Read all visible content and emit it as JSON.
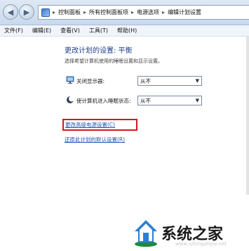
{
  "address_bar": {
    "crumbs": [
      "控制面板",
      "所有控制面板项",
      "电源选项",
      "编辑计划设置"
    ]
  },
  "menu": [
    "文件(F)",
    "编辑(E)",
    "查看(V)",
    "工具(T)",
    "帮助(H)"
  ],
  "page": {
    "title": "更改计划的设置: 平衡",
    "subtitle": "选择希望计算机使用的睡眠设置和显示设置。",
    "settings": [
      {
        "label": "关闭显示器:",
        "value": "从不",
        "icon": "monitor-icon"
      },
      {
        "label": "使计算机进入睡眠状态:",
        "value": "从不",
        "icon": "moon-icon"
      }
    ],
    "advanced_link": "更改高级电源设置(C)",
    "restore_link": "还原此计划的默认设置(R)"
  },
  "watermark": {
    "text": "系统之家",
    "url": "www.xitongzhijia.net"
  },
  "colors": {
    "link": "#1f56b8",
    "title": "#1e3f8a",
    "highlight_border": "#d21a1a"
  }
}
